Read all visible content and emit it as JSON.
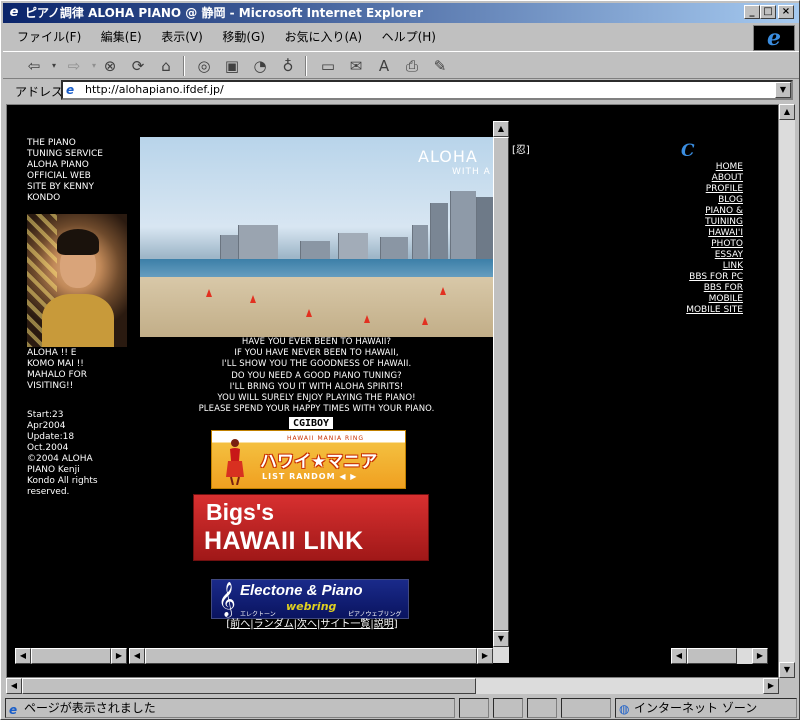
{
  "window": {
    "title": "ピアノ調律 ALOHA PIANO @ 静岡 - Microsoft Internet Explorer",
    "minimize": "_",
    "maximize": "□",
    "close": "×"
  },
  "menu": [
    "ファイル(F)",
    "編集(E)",
    "表示(V)",
    "移動(G)",
    "お気に入り(A)",
    "ヘルプ(H)"
  ],
  "address": {
    "label": "アドレス",
    "url": "http://alohapiano.ifdef.jp/"
  },
  "status": {
    "message": "ページが表示されました",
    "zone": "インターネット ゾーン"
  },
  "left_frame": {
    "intro": "THE PIANO TUNING SERVICE ALOHA PIANO OFFICIAL WEB SITE BY KENNY KONDO",
    "greeting": "ALOHA !! E KOMO MAI !! MAHALO FOR VISITING!!",
    "info": "Start:23 Apr2004 Update:18 Oct.2004 ©2004 ALOHA PIANO Kenji Kondo All rights reserved."
  },
  "main_frame": {
    "banner_title": "ALOHA",
    "banner_sub": "WITH A",
    "message": "HAVE YOU EVER BEEN TO HAWAII?\nIF YOU HAVE NEVER BEEN TO  HAWAII,\nI'LL SHOW YOU THE GOODNESS OF HAWAII.\nDO YOU NEED A GOOD PIANO TUNING?\nI'LL BRING YOU IT WITH ALOHA SPIRITS!\nYOU WILL SURELY ENJOY PLAYING THE PIANO!\nPLEASE SPEND YOUR HAPPY TIMES WITH YOUR PIANO.",
    "cgiboy": "CGIBOY",
    "hawaii_ring": {
      "ring": "HAWAII MANIA RING",
      "title": "ハワイ★マニア",
      "list": "LIST  RANDOM  ◀ ▶"
    },
    "bigs": {
      "line1": "Bigs's",
      "line2": "HAWAII LINK"
    },
    "electone": {
      "title": "Electone & Piano",
      "webring": "webring",
      "kana_left": "エレクトーン",
      "kana_right": "ピアノウェブリング"
    },
    "ring_nav": [
      "前へ",
      "ランダム",
      "次へ",
      "サイト一覧",
      "説明"
    ]
  },
  "right_frame": {
    "bracket": "[忍]",
    "logo": "C",
    "nav": [
      "HOME",
      "ABOUT",
      "PROFILE",
      "BLOG",
      "PIANO &",
      "TUINING",
      "HAWAI'I",
      "PHOTO",
      "ESSAY",
      "LINK",
      "BBS FOR PC",
      "BBS FOR",
      "MOBILE",
      "MOBILE SITE"
    ]
  }
}
